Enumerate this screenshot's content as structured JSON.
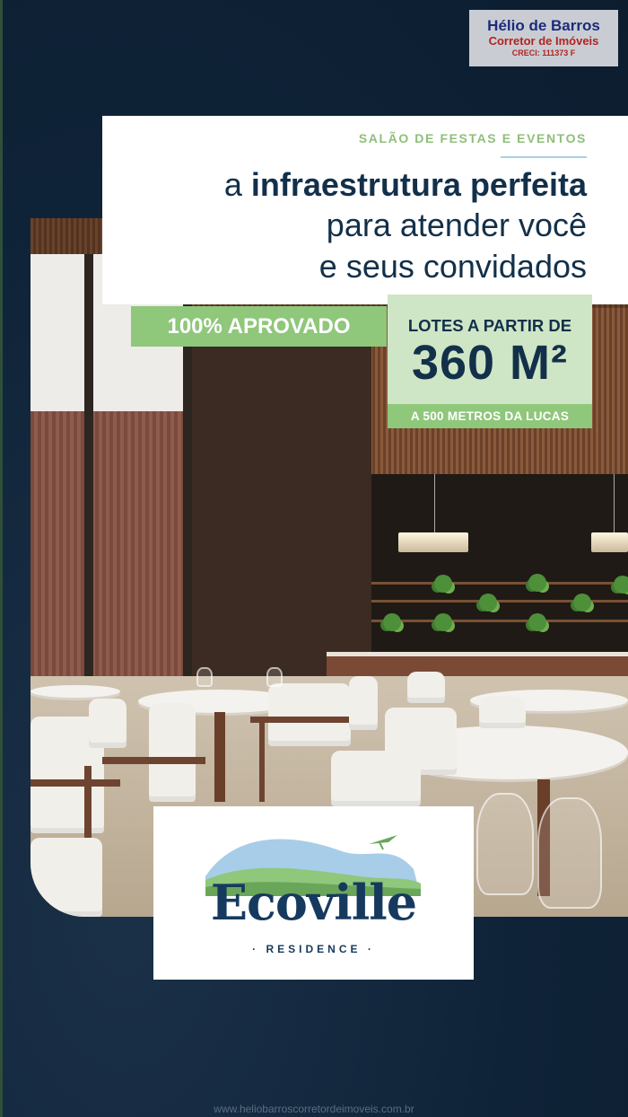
{
  "broker": {
    "name": "Hélio de Barros",
    "role": "Corretor de Imóveis",
    "creci": "CRECI: 111373 F"
  },
  "headline": {
    "eyebrow": "SALÃO DE FESTAS E EVENTOS",
    "line1_regular": "a",
    "line1_bold": "infraestrutura perfeita",
    "line2": "para atender você",
    "line3": "e seus convidados"
  },
  "badges": {
    "approved": "100% APROVADO",
    "lots_label": "LOTES A PARTIR DE",
    "lots_size": "360 M²",
    "distance": "A 500 METROS DA LUCAS"
  },
  "logo": {
    "word": "Ecoville",
    "sub": "RESIDENCE"
  },
  "watermark": "www.heliobarroscorretordeimoveis.com.br",
  "colors": {
    "background": "#0f2338",
    "navy": "#13304a",
    "green": "#8fc77b",
    "light_green": "#cfe6c6",
    "broker_blue": "#1d2b7a",
    "broker_red": "#b3231f"
  }
}
